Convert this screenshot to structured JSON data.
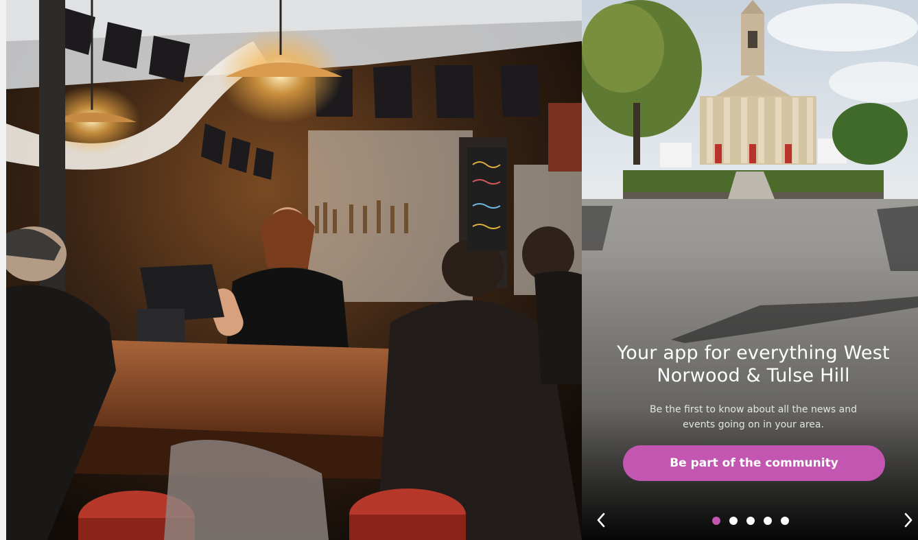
{
  "onboarding": {
    "headline_line1": "Your app for everything West",
    "headline_line2": "Norwood & Tulse Hill",
    "subtext_line1": "Be the first to know about all the news and",
    "subtext_line2": "events going on in your area.",
    "cta_label": "Be part of the community",
    "pagination": {
      "total": 5,
      "active_index": 0
    },
    "prev_icon": "chevron-left-icon",
    "next_icon": "chevron-right-icon"
  },
  "colors": {
    "accent": "#c256b1",
    "dot_inactive": "#ffffff",
    "text": "#ffffff"
  }
}
